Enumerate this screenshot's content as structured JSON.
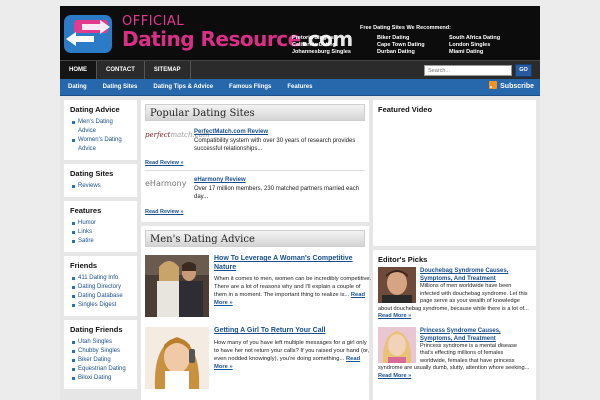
{
  "header": {
    "logo_top": "OFFICIAL",
    "logo_main": "Dating Resource",
    "logo_suffix": ".com",
    "promo_title": "Free Dating Sites We Recommend:",
    "promo_links": [
      "Pretoria Singles",
      "Biker Dating",
      "South Africa Dating",
      "California Dating",
      "Cape Town Dating",
      "London Singles",
      "Johannesburg Singles",
      "Durban Dating",
      "Miami Dating"
    ]
  },
  "topnav": {
    "items": [
      "HOME",
      "CONTACT",
      "SITEMAP"
    ],
    "search_placeholder": "Search...",
    "search_button": "GO"
  },
  "catnav": {
    "items": [
      "Dating",
      "Dating Sites",
      "Dating Tips & Advice",
      "Famous Flings",
      "Features"
    ],
    "subscribe": "Subscribe"
  },
  "sidebar": {
    "widgets": [
      {
        "title": "Dating Advice",
        "items": [
          "Men's Dating Advice",
          "Women's Dating Advice"
        ]
      },
      {
        "title": "Dating Sites",
        "items": [
          "Reviews"
        ]
      },
      {
        "title": "Features",
        "items": [
          "Humor",
          "Links",
          "Satire"
        ]
      },
      {
        "title": "Friends",
        "items": [
          "411 Dating Info",
          "Dating Directory",
          "Dating Database",
          "Singles Digest"
        ]
      },
      {
        "title": "Dating Friends",
        "items": [
          "Utah Singles",
          "Chubby Singles",
          "Biker Dating",
          "Equestrian Dating",
          "Biloxi Dating"
        ]
      }
    ]
  },
  "popular_sites": {
    "title": "Popular Dating Sites",
    "sites": [
      {
        "logo": "perfectmatch.com",
        "link": "PerfectMatch.com Review",
        "desc": "Compatibility system with over 30 years of research provides successful relationships...",
        "readmore": "Read Review »"
      },
      {
        "logo": "eHarmony",
        "link": "eHarmony Review",
        "desc": "Over 17 million members, 230 matched partners married each day...",
        "readmore": "Read Review »"
      }
    ]
  },
  "mens_advice": {
    "title": "Men's Dating Advice",
    "posts": [
      {
        "title": "How To Leverage A Woman's Competitive Nature",
        "excerpt": "When it comes to men, women can be incredibly competitive. There are a lot of reasons why and I'll explain a couple of them in a moment. The important thing to realize is...",
        "readmore": "Read More »"
      },
      {
        "title": "Getting A Girl To Return Your Call",
        "excerpt": "How many of you have left multiple messages for a girl only to have her not return your calls? If you raised your hand (or, even nodded knowingly), you're doing something...",
        "readmore": "Read More »"
      }
    ]
  },
  "featured_video": {
    "title": "Featured Video"
  },
  "editors_picks": {
    "title": "Editor's Picks",
    "picks": [
      {
        "title": "Douchebag Syndrome Causes, Symptoms, And Treatment",
        "text": "Millions of men worldwide have been infected with douchebag syndrome. Let this page serve as your wealth of knowledge about douchebag syndrome, because while there is a lot of...",
        "readmore": "Read More »"
      },
      {
        "title": "Princess Syndrome Causes, Symptoms, And Treatment",
        "text": "Princess syndrome is a mental disease that's effecting millions of females worldwide, females that have princess syndrome are usually dumb, slutty, attention whore seeking...",
        "readmore": "Read More »"
      }
    ]
  },
  "colors": {
    "accent": "#d92f86",
    "nav_blue": "#2768ad",
    "header_bg": "#0c0c0c",
    "link": "#1a4f8f"
  }
}
